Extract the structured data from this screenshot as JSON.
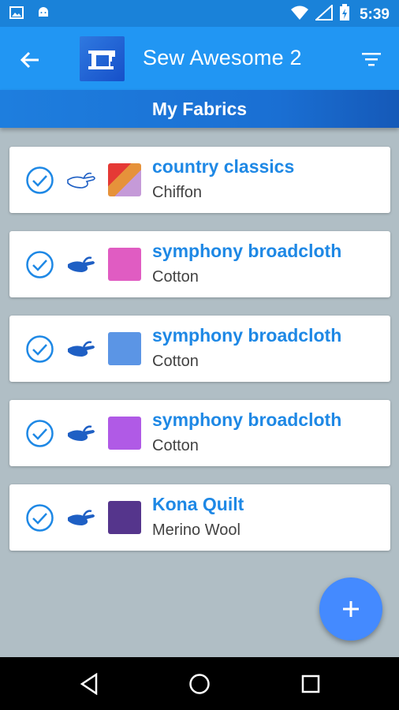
{
  "status_bar": {
    "time": "5:39",
    "icons": [
      "image-icon",
      "android-icon",
      "wifi-icon",
      "signal-icon",
      "battery-charging-icon"
    ]
  },
  "app_bar": {
    "title": "Sew Awesome 2",
    "icons": [
      "back-arrow-icon",
      "sewing-machine-logo",
      "filter-icon"
    ]
  },
  "sub_bar": {
    "title": "My Fabrics"
  },
  "fabrics": [
    {
      "name": "country classics",
      "type": "Chiffon",
      "care_icon": "hand-wash-outline-icon",
      "swatch": "multicolor"
    },
    {
      "name": "symphony broadcloth",
      "type": "Cotton",
      "care_icon": "hand-wash-icon",
      "swatch": "#e05cc2"
    },
    {
      "name": "symphony broadcloth",
      "type": "Cotton",
      "care_icon": "hand-wash-icon",
      "swatch": "#5b95e5"
    },
    {
      "name": "symphony broadcloth",
      "type": "Cotton",
      "care_icon": "hand-wash-icon",
      "swatch": "#b05ae6"
    },
    {
      "name": "Kona Quilt",
      "type": "Merino Wool",
      "care_icon": "hand-wash-icon",
      "swatch": "#55358c"
    }
  ],
  "fab": {
    "icon": "plus-icon"
  },
  "colors": {
    "primary": "#2196f3",
    "status": "#1a82d9",
    "accent": "#448aff",
    "text_accent": "#1e88e5",
    "background": "#b0bec5"
  }
}
